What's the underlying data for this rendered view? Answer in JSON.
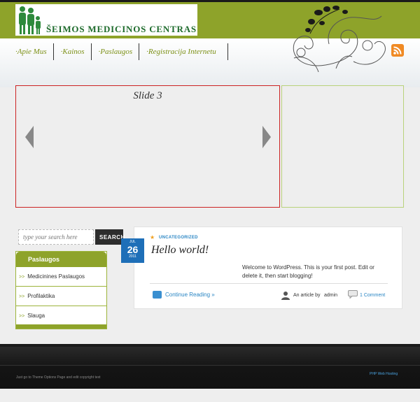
{
  "header": {
    "logo_text": "ŠEIMOS MEDICINOS CENTRAS"
  },
  "nav": {
    "items": [
      {
        "label": "·Apie Mus"
      },
      {
        "label": "·Kainos"
      },
      {
        "label": "·Paslaugos"
      },
      {
        "label": "·Registracija Internetu"
      }
    ]
  },
  "slider": {
    "title": "Slide 3"
  },
  "search": {
    "placeholder": "type your search here",
    "button_label": "SEARCH"
  },
  "widget": {
    "title": "Paslaugos",
    "bullet": ">>",
    "items": [
      {
        "label": "Medicinines Paslaugos"
      },
      {
        "label": "Profilaktika"
      },
      {
        "label": "Slauga"
      }
    ]
  },
  "post": {
    "category": "UNCATEGORIZED",
    "date": {
      "month": "JUL",
      "day": "26",
      "year": "2011"
    },
    "title": "Hello world!",
    "excerpt": "Welcome to WordPress. This is your first post. Edit or delete it, then start blogging!",
    "continue_label": "Continue Reading »",
    "author_prefix": "An article by",
    "author_name": "admin",
    "comments_label": "1 Comment"
  },
  "footer": {
    "left_text": "Just go to Theme Options Page and edit copyright text",
    "right_link": "PHP Web Hosting"
  },
  "colors": {
    "brand_green": "#8ea32a",
    "link_blue": "#2a86c4",
    "rss_orange": "#f08a24"
  },
  "icons": [
    "family-logo-icon",
    "swirl-ornament-icon",
    "rss-icon",
    "arrow-left-icon",
    "arrow-right-icon",
    "star-icon",
    "comment-icon",
    "author-icon",
    "continue-icon"
  ]
}
